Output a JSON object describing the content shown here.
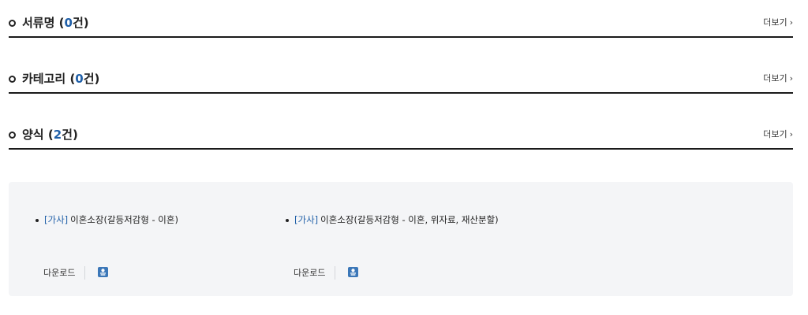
{
  "sections": [
    {
      "title": "서류명",
      "count_open": "(",
      "count": "0",
      "count_close": "건)",
      "more": "더보기"
    },
    {
      "title": "카테고리",
      "count_open": "(",
      "count": "0",
      "count_close": "건)",
      "more": "더보기"
    },
    {
      "title": "양식",
      "count_open": "(",
      "count": "2",
      "count_close": "건)",
      "more": "더보기"
    }
  ],
  "results": [
    {
      "tag": "[가사]",
      "name": "이혼소장(갈등저감형 - 이혼)",
      "download_label": "다운로드",
      "icon": "download-icon"
    },
    {
      "tag": "[가사]",
      "name": "이혼소장(갈등저감형 - 이혼, 위자료, 재산분할)",
      "download_label": "다운로드",
      "icon": "download-icon"
    }
  ],
  "colors": {
    "accent": "#1f5fa8",
    "panel_bg": "#f4f5f7",
    "download_icon_bg": "#3b77b8"
  }
}
